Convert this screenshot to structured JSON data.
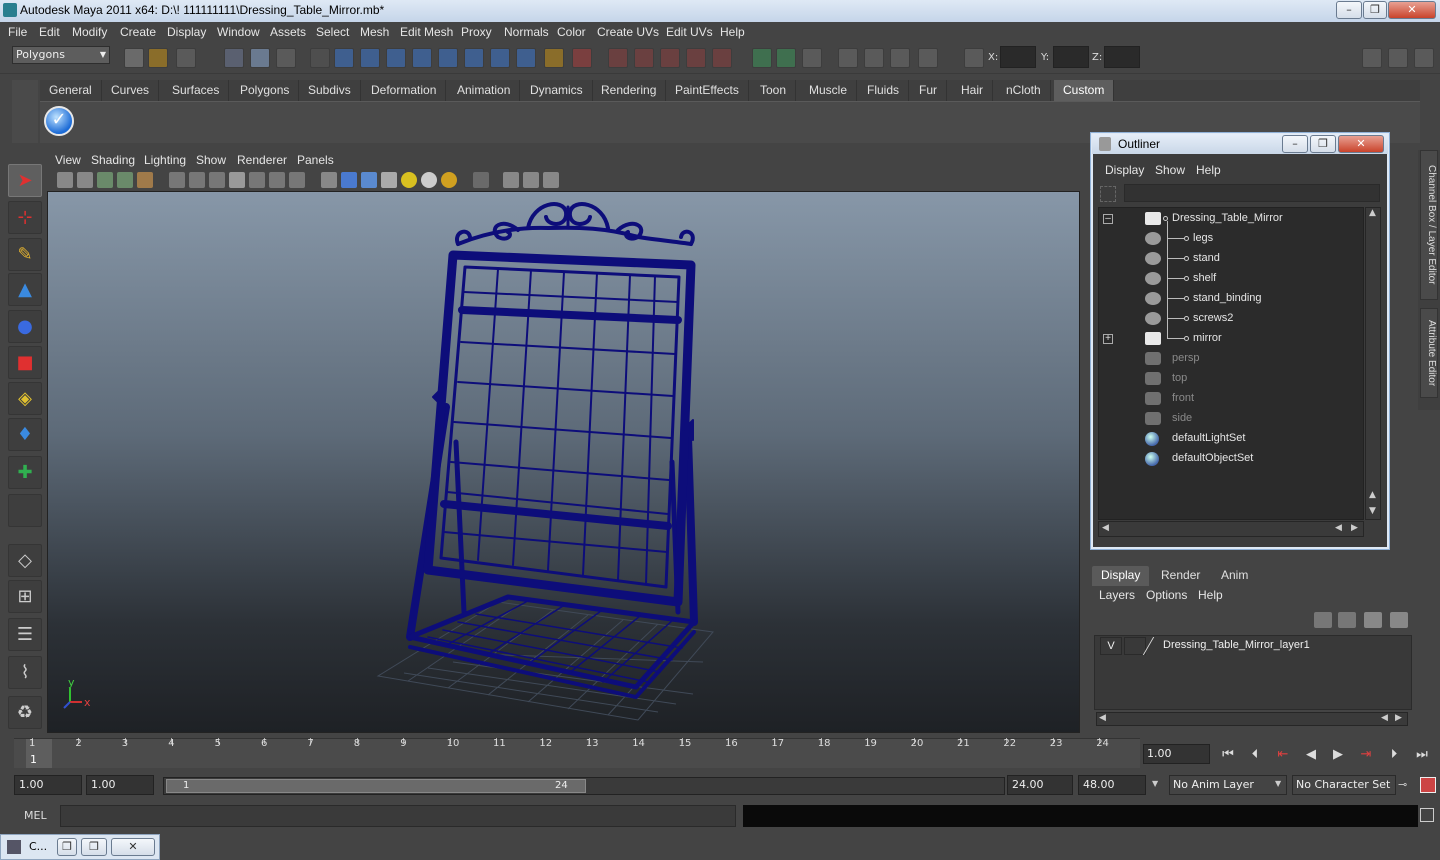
{
  "window": {
    "title": "Autodesk Maya 2011 x64: D:\\! 111111111\\Dressing_Table_Mirror.mb*",
    "min": "–",
    "max": "❐",
    "close": "✕"
  },
  "menubar": [
    "File",
    "Edit",
    "Modify",
    "Create",
    "Display",
    "Window",
    "Assets",
    "Select",
    "Mesh",
    "Edit Mesh",
    "Proxy",
    "Normals",
    "Color",
    "Create UVs",
    "Edit UVs",
    "Help"
  ],
  "statusline": {
    "mode": "Polygons",
    "x_label": "X:",
    "y_label": "Y:",
    "z_label": "Z:"
  },
  "shelf": {
    "tabs": [
      "General",
      "Curves",
      "Surfaces",
      "Polygons",
      "Subdivs",
      "Deformation",
      "Animation",
      "Dynamics",
      "Rendering",
      "PaintEffects",
      "Toon",
      "Muscle",
      "Fluids",
      "Fur",
      "Hair",
      "nCloth",
      "Custom"
    ],
    "active_tab": "Custom"
  },
  "viewport": {
    "menus": [
      "View",
      "Shading",
      "Lighting",
      "Show",
      "Renderer",
      "Panels"
    ],
    "axis_x": "x",
    "axis_y": "y",
    "model_color": "#0d0d7a"
  },
  "outliner": {
    "title": "Outliner",
    "menus": [
      "Display",
      "Show",
      "Help"
    ],
    "items": [
      {
        "label": "Dressing_Table_Mirror",
        "dim": false
      },
      {
        "label": "legs",
        "dim": false
      },
      {
        "label": "stand",
        "dim": false
      },
      {
        "label": "shelf",
        "dim": false
      },
      {
        "label": "stand_binding",
        "dim": false
      },
      {
        "label": "screws2",
        "dim": false
      },
      {
        "label": "mirror",
        "dim": false
      },
      {
        "label": "persp",
        "dim": true
      },
      {
        "label": "top",
        "dim": true
      },
      {
        "label": "front",
        "dim": true
      },
      {
        "label": "side",
        "dim": true
      },
      {
        "label": "defaultLightSet",
        "dim": false
      },
      {
        "label": "defaultObjectSet",
        "dim": false
      }
    ]
  },
  "sidetabs": {
    "channel": "Channel Box / Layer Editor",
    "attribute": "Attribute Editor"
  },
  "layer_editor": {
    "tabs": [
      "Display",
      "Render",
      "Anim"
    ],
    "active_tab": "Display",
    "menus": [
      "Layers",
      "Options",
      "Help"
    ],
    "layer": {
      "visible": "V",
      "name": "Dressing_Table_Mirror_layer1"
    }
  },
  "timeslider": {
    "ticks": [
      "1",
      "2",
      "3",
      "4",
      "5",
      "6",
      "7",
      "8",
      "9",
      "10",
      "11",
      "12",
      "13",
      "14",
      "15",
      "16",
      "17",
      "18",
      "19",
      "20",
      "21",
      "22",
      "23",
      "24"
    ],
    "current_frame": "1",
    "current_time": "1.00"
  },
  "rangebar": {
    "start_time": "1.00",
    "playback_start": "1.00",
    "range_start": "1",
    "range_end": "24",
    "playback_end": "24.00",
    "end_time": "48.00",
    "anim_layer": "No Anim Layer",
    "character_set": "No Character Set"
  },
  "cmdline": {
    "label": "MEL"
  },
  "minibar": {
    "label": "C..."
  }
}
